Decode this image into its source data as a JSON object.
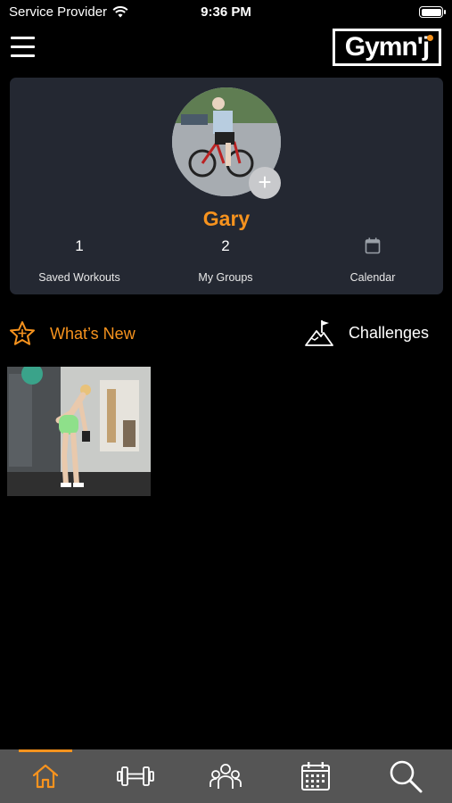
{
  "status_bar": {
    "carrier": "Service Provider",
    "time": "9:36 PM"
  },
  "header": {
    "logo_text": "Gymn'j"
  },
  "profile": {
    "name": "Gary",
    "add_photo_label": "+",
    "stats": [
      {
        "value": "1",
        "label": "Saved Workouts"
      },
      {
        "value": "2",
        "label": "My Groups"
      },
      {
        "value": "",
        "label": "Calendar",
        "icon": "calendar-icon"
      }
    ]
  },
  "sections": {
    "whats_new": {
      "label": "What’s New",
      "icon": "star-icon"
    },
    "challenges": {
      "label": "Challenges",
      "icon": "mountain-flag-icon"
    }
  },
  "tab_bar": {
    "tabs": [
      {
        "icon": "home-icon",
        "active": true
      },
      {
        "icon": "dumbbell-icon",
        "active": false
      },
      {
        "icon": "group-icon",
        "active": false
      },
      {
        "icon": "calendar-icon",
        "active": false
      },
      {
        "icon": "search-icon",
        "active": false
      }
    ]
  },
  "colors": {
    "accent": "#f7931e",
    "card_bg": "#242832",
    "tab_bar_bg": "#555555",
    "background": "#000000"
  }
}
